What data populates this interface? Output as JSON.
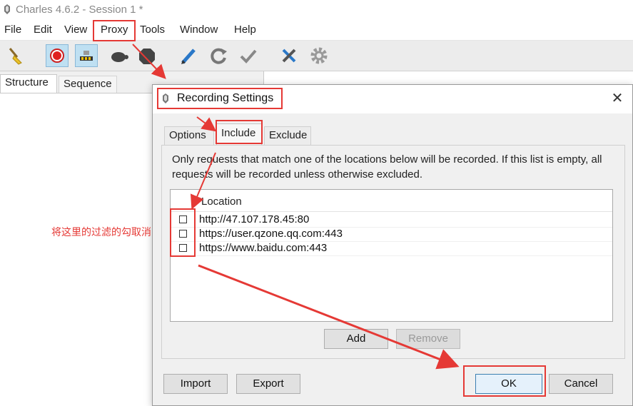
{
  "window": {
    "title": "Charles 4.6.2 - Session 1 *"
  },
  "menu": [
    "File",
    "Edit",
    "View",
    "Proxy",
    "Tools",
    "Window",
    "Help"
  ],
  "toolbar": {
    "icons": [
      "broom-icon",
      "record-icon",
      "throttle-icon",
      "turtle-icon",
      "stop-sign-icon",
      "pen-icon",
      "refresh-icon",
      "check-icon",
      "tools-icon",
      "gear-icon"
    ]
  },
  "left_tabs": [
    "Structure",
    "Sequence"
  ],
  "dialog": {
    "title": "Recording Settings",
    "close": "✕",
    "tabs": [
      "Options",
      "Include",
      "Exclude"
    ],
    "active_tab": "Include",
    "description": "Only requests that match one of the locations below will be recorded. If this list is empty, all requests will be recorded unless otherwise excluded.",
    "table_header": "Location",
    "locations": [
      {
        "value": "http://47.107.178.45:80",
        "checked": false
      },
      {
        "value": "https://user.qzone.qq.com:443",
        "checked": false
      },
      {
        "value": "https://www.baidu.com:443",
        "checked": false
      }
    ],
    "buttons": {
      "add": "Add",
      "remove": "Remove",
      "import": "Import",
      "export": "Export",
      "ok": "OK",
      "cancel": "Cancel"
    }
  },
  "annotation": {
    "note": "将这里的过滤的勾取消"
  },
  "colors": {
    "highlight": "#e53935",
    "toolbar_bg": "#ececec",
    "dialog_bg": "#f0f0f0"
  }
}
